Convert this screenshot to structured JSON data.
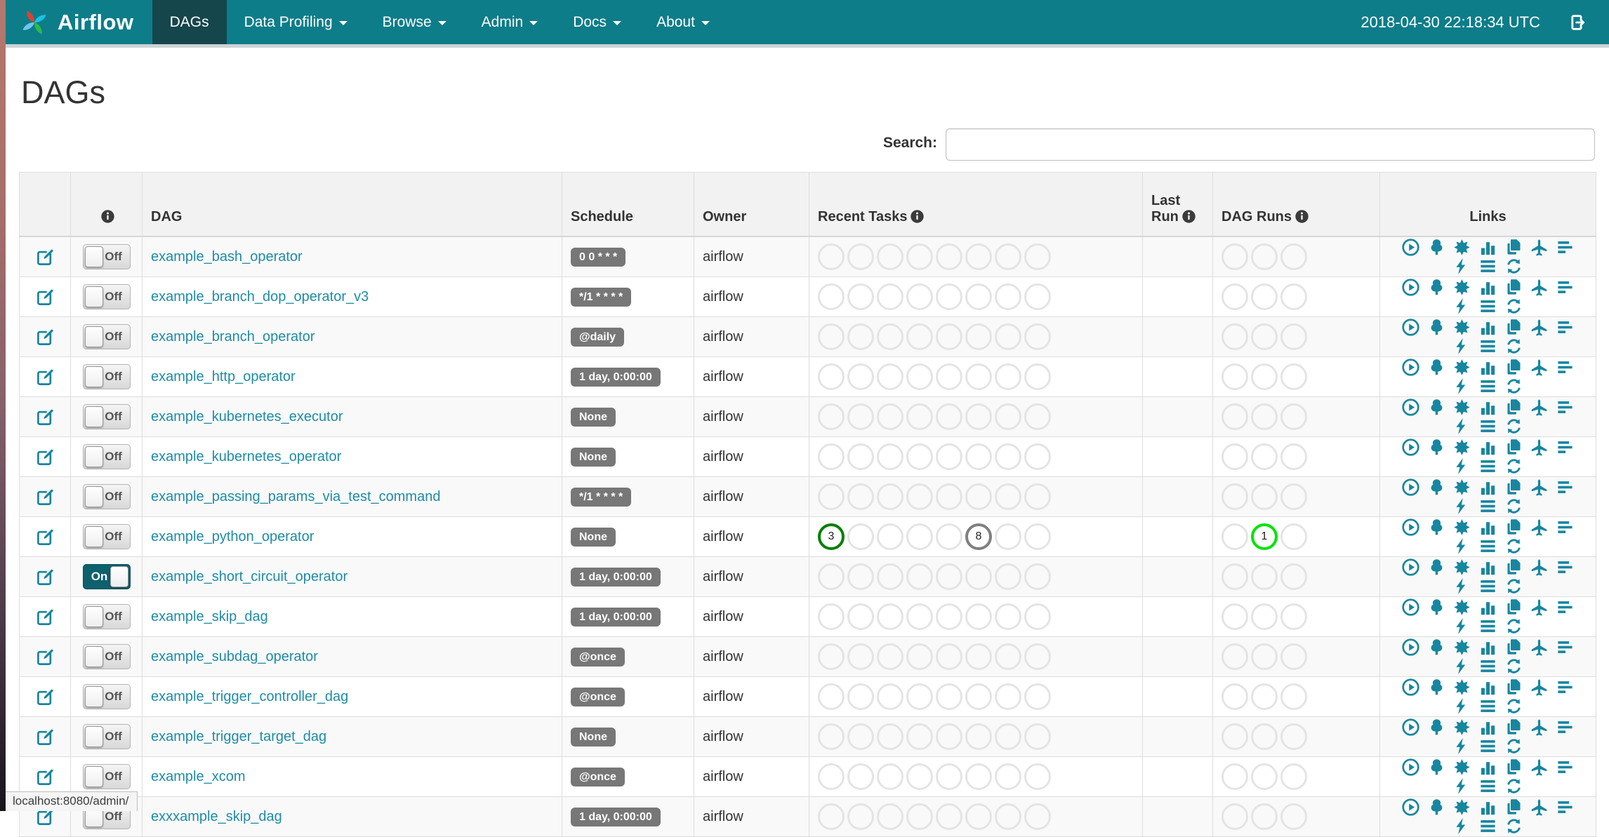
{
  "colors": {
    "navbar_bg": "#0d7d89",
    "navbar_active_bg": "#14464c",
    "accent_teal": "#17869f",
    "badge_bg": "#777777",
    "toggle_on_bg": "#0d616d",
    "circle_border_default": "#e4e4e4",
    "state_success": "#008000",
    "state_none": "#808080",
    "state_running": "#00e400"
  },
  "navbar": {
    "brand": "Airflow",
    "items": [
      {
        "label": "DAGs",
        "active": true,
        "has_caret": false
      },
      {
        "label": "Data Profiling",
        "active": false,
        "has_caret": true
      },
      {
        "label": "Browse",
        "active": false,
        "has_caret": true
      },
      {
        "label": "Admin",
        "active": false,
        "has_caret": true
      },
      {
        "label": "Docs",
        "active": false,
        "has_caret": true
      },
      {
        "label": "About",
        "active": false,
        "has_caret": true
      }
    ],
    "clock": "2018-04-30 22:18:34 UTC"
  },
  "page": {
    "title": "DAGs",
    "search_label": "Search:",
    "search_value": "",
    "status_bar_text": "localhost:8080/admin/"
  },
  "table": {
    "headers": {
      "dag": "DAG",
      "schedule": "Schedule",
      "owner": "Owner",
      "recent_tasks": "Recent Tasks",
      "last_run": "Last Run",
      "dag_runs": "DAG Runs",
      "links": "Links"
    },
    "recent_task_slots": 8,
    "dag_run_slots": 3,
    "link_icons": [
      "trigger-dag",
      "tree-view",
      "graph-view",
      "tasks-duration",
      "task-tries",
      "landing-times",
      "gantt-view",
      "code-view",
      "logs",
      "refresh"
    ],
    "rows": [
      {
        "name": "example_bash_operator",
        "toggle": "Off",
        "schedule": "0 0 * * *",
        "owner": "airflow",
        "recent_tasks": {},
        "dag_runs": {}
      },
      {
        "name": "example_branch_dop_operator_v3",
        "toggle": "Off",
        "schedule": "*/1 * * * *",
        "owner": "airflow",
        "recent_tasks": {},
        "dag_runs": {}
      },
      {
        "name": "example_branch_operator",
        "toggle": "Off",
        "schedule": "@daily",
        "owner": "airflow",
        "recent_tasks": {},
        "dag_runs": {}
      },
      {
        "name": "example_http_operator",
        "toggle": "Off",
        "schedule": "1 day, 0:00:00",
        "owner": "airflow",
        "recent_tasks": {},
        "dag_runs": {}
      },
      {
        "name": "example_kubernetes_executor",
        "toggle": "Off",
        "schedule": "None",
        "owner": "airflow",
        "recent_tasks": {},
        "dag_runs": {}
      },
      {
        "name": "example_kubernetes_operator",
        "toggle": "Off",
        "schedule": "None",
        "owner": "airflow",
        "recent_tasks": {},
        "dag_runs": {}
      },
      {
        "name": "example_passing_params_via_test_command",
        "toggle": "Off",
        "schedule": "*/1 * * * *",
        "owner": "airflow",
        "recent_tasks": {},
        "dag_runs": {}
      },
      {
        "name": "example_python_operator",
        "toggle": "Off",
        "schedule": "None",
        "owner": "airflow",
        "recent_tasks": {
          "0": {
            "count": "3",
            "state": "success"
          },
          "5": {
            "count": "8",
            "state": "none"
          }
        },
        "dag_runs": {
          "1": {
            "count": "1",
            "state": "running"
          }
        }
      },
      {
        "name": "example_short_circuit_operator",
        "toggle": "On",
        "schedule": "1 day, 0:00:00",
        "owner": "airflow",
        "recent_tasks": {},
        "dag_runs": {}
      },
      {
        "name": "example_skip_dag",
        "toggle": "Off",
        "schedule": "1 day, 0:00:00",
        "owner": "airflow",
        "recent_tasks": {},
        "dag_runs": {}
      },
      {
        "name": "example_subdag_operator",
        "toggle": "Off",
        "schedule": "@once",
        "owner": "airflow",
        "recent_tasks": {},
        "dag_runs": {}
      },
      {
        "name": "example_trigger_controller_dag",
        "toggle": "Off",
        "schedule": "@once",
        "owner": "airflow",
        "recent_tasks": {},
        "dag_runs": {}
      },
      {
        "name": "example_trigger_target_dag",
        "toggle": "Off",
        "schedule": "None",
        "owner": "airflow",
        "recent_tasks": {},
        "dag_runs": {}
      },
      {
        "name": "example_xcom",
        "toggle": "Off",
        "schedule": "@once",
        "owner": "airflow",
        "recent_tasks": {},
        "dag_runs": {}
      },
      {
        "name": "exxxample_skip_dag",
        "toggle": "Off",
        "schedule": "1 day, 0:00:00",
        "owner": "airflow",
        "recent_tasks": {},
        "dag_runs": {}
      }
    ]
  }
}
